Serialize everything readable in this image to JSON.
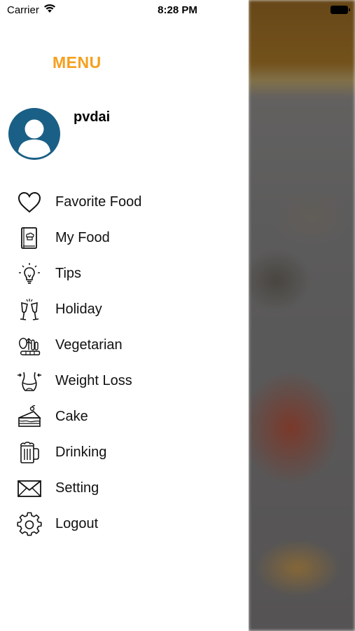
{
  "status_bar": {
    "carrier": "Carrier",
    "time": "8:28 PM"
  },
  "drawer": {
    "title": "MENU",
    "title_color": "#f5a01e",
    "user": {
      "name": "pvdai",
      "avatar_color": "#1a5f86"
    },
    "items": [
      {
        "label": "Favorite Food",
        "icon": "heart-icon"
      },
      {
        "label": "My Food",
        "icon": "recipe-book-icon"
      },
      {
        "label": "Tips",
        "icon": "lightbulb-icon"
      },
      {
        "label": "Holiday",
        "icon": "champagne-glasses-icon"
      },
      {
        "label": "Vegetarian",
        "icon": "vegetables-icon"
      },
      {
        "label": "Weight Loss",
        "icon": "waist-icon"
      },
      {
        "label": "Cake",
        "icon": "cake-slice-icon"
      },
      {
        "label": "Drinking",
        "icon": "beer-mug-icon"
      },
      {
        "label": "Setting",
        "icon": "envelope-icon"
      },
      {
        "label": "Logout",
        "icon": "gear-icon"
      }
    ]
  }
}
